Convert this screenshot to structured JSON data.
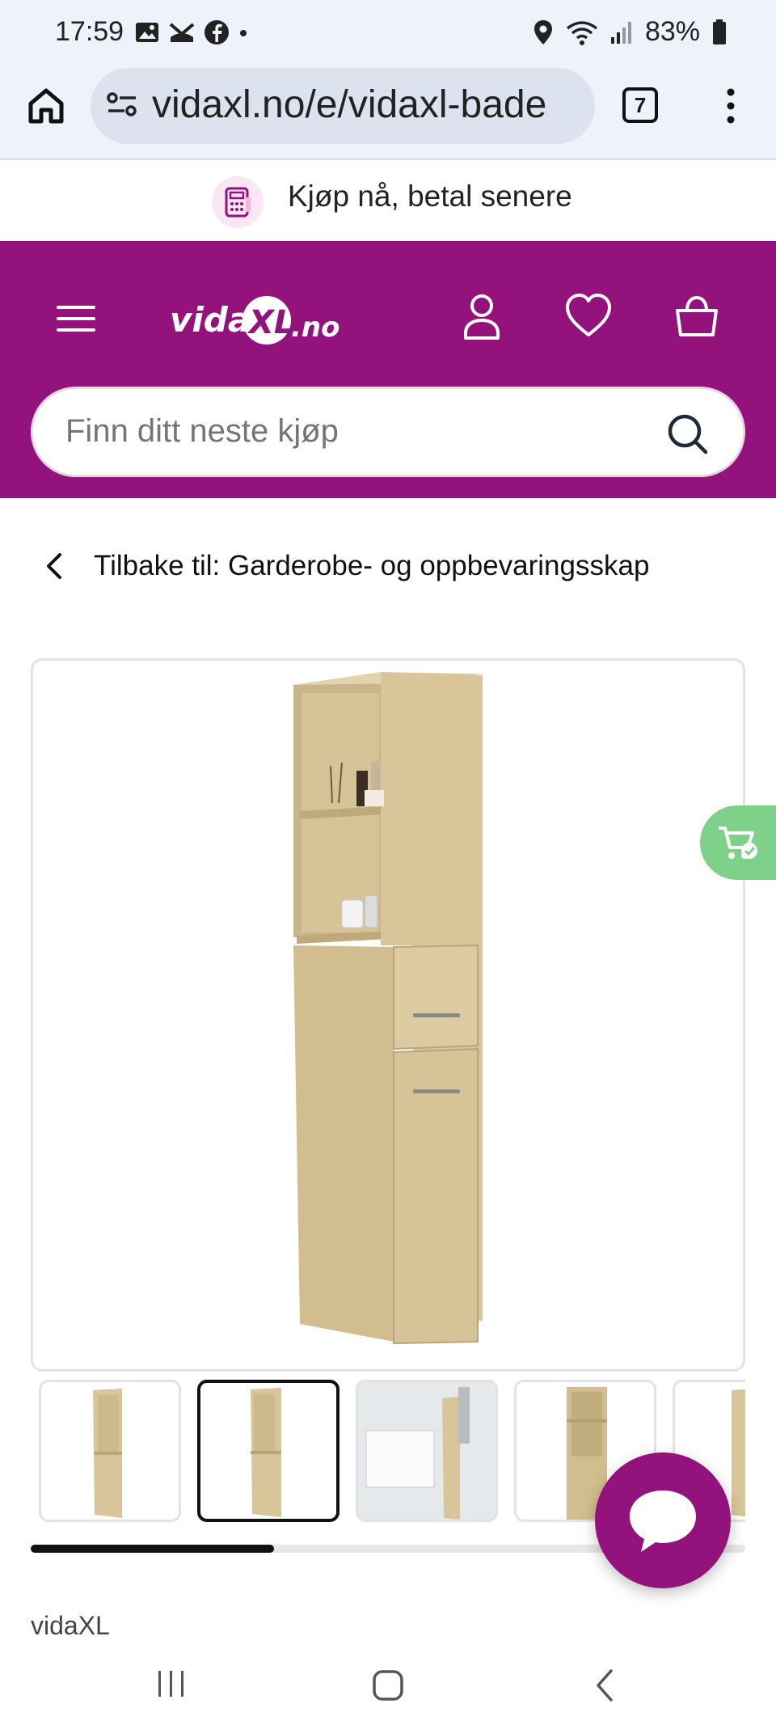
{
  "status_bar": {
    "time": "17:59",
    "battery": "83%",
    "left_icons": [
      "gallery-icon",
      "missed-call-icon",
      "facebook-icon",
      "dot-icon"
    ],
    "right_icons": [
      "location-icon",
      "wifi-icon",
      "signal-icon",
      "battery-icon"
    ]
  },
  "browser": {
    "url": "vidaxl.no/e/vidaxl-bade",
    "tab_count": "7"
  },
  "promo": {
    "text": "Kjøp nå, betal senere"
  },
  "header": {
    "logo": "vidaXL.no",
    "search_placeholder": "Finn ditt neste kjøp",
    "brand_color": "#93127c"
  },
  "breadcrumb": {
    "back_label": "Tilbake til: Garderobe- og oppbevaringsskap"
  },
  "gallery": {
    "thumbnail_count_visible": 5,
    "active_thumbnail": 2,
    "scroll_progress": 0.34
  },
  "product": {
    "brand": "vidaXL"
  },
  "colors": {
    "accent": "#93127c",
    "compare": "#7fd18a",
    "wood": "#d8c59a"
  }
}
